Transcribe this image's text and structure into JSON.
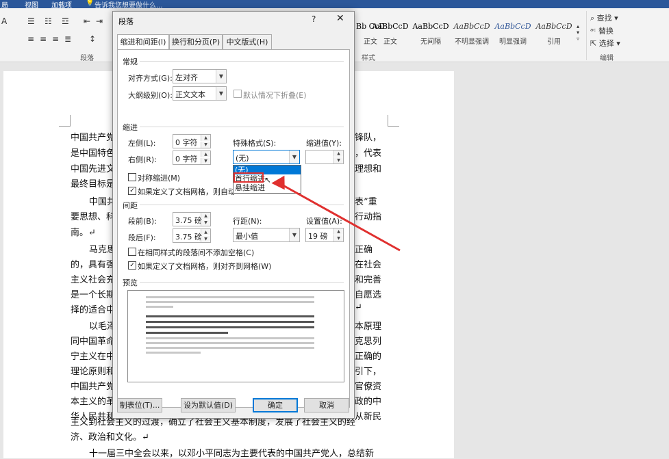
{
  "titlebar": {
    "items": [
      "局",
      "视图",
      "加载项",
      "告诉我您想要做什么..."
    ]
  },
  "ribbon": {
    "paragraph_group": "段落",
    "styles_group": "样式",
    "edit_group": "编辑",
    "styles": [
      {
        "preview": "Bb CcD",
        "name": "正文"
      },
      {
        "preview": "AaBbCcD",
        "name": "正文"
      },
      {
        "preview": "AaBbCcD",
        "name": "无间隔"
      },
      {
        "preview": "AaBbCcD",
        "name": "不明显强调"
      },
      {
        "preview": "AaBbCcD",
        "name": "明显强调"
      },
      {
        "preview": "AaBbCcD",
        "name": "引用"
      }
    ],
    "find": "查找",
    "replace": "替换",
    "select": "选择"
  },
  "document": {
    "lines": [
      {
        "left": "中国共产党",
        "right": "锋队，"
      },
      {
        "left": "是中国特色",
        "right": "，代表"
      },
      {
        "left": "中国先进文",
        "right": "理想和"
      },
      {
        "left": "最终目标是",
        "right": ""
      },
      {
        "left": "中国共",
        "right": "代表”重"
      },
      {
        "left": "要思想、科",
        "right": "行动指"
      },
      {
        "left": "南。↵",
        "right": ""
      },
      {
        "left": "马克思",
        "right": "正确"
      },
      {
        "left": "的，具有强",
        "right": "在社会"
      },
      {
        "left": "主义社会充",
        "right": "和完善"
      },
      {
        "left": "是一个长期",
        "right": "自愿选"
      },
      {
        "left": "择的适合中",
        "right": "↵"
      },
      {
        "left": "以毛泽",
        "right": "本原理"
      },
      {
        "left": "同中国革命",
        "right": "克思列"
      },
      {
        "left": "宁主义在中",
        "right": "正确的"
      },
      {
        "left": "理论原则和",
        "right": "引下，"
      },
      {
        "left": "中国共产党",
        "right": "官僚资"
      },
      {
        "left": "本主义的革",
        "right": "政的中"
      },
      {
        "left": "华人民共和",
        "right": "从新民"
      }
    ],
    "full_line_1": "主义到社会主义的过渡，确立了社会主义基本制度，发展了社会主义的经",
    "full_line_2": "济、政治和文化。↵",
    "full_line_3": "十一届三中全会以来，以邓小平同志为主要代表的中国共产党人，总结新"
  },
  "dialog": {
    "title": "段落",
    "help": "?",
    "tabs": [
      "缩进和间距(I)",
      "换行和分页(P)",
      "中文版式(H)"
    ],
    "general": {
      "section": "常规",
      "alignment_label": "对齐方式(G):",
      "alignment_value": "左对齐",
      "outline_label": "大纲级别(O):",
      "outline_value": "正文文本",
      "collapse_label": "默认情况下折叠(E)"
    },
    "indent": {
      "section": "缩进",
      "left_label": "左侧(L):",
      "left_value": "0 字符",
      "right_label": "右侧(R):",
      "right_value": "0 字符",
      "special_label": "特殊格式(S):",
      "special_value": "(无)",
      "by_label": "缩进值(Y):",
      "mirror_label": "对称缩进(M)",
      "grid_label": "如果定义了文档网格，则自动调整右缩进(D)",
      "dropdown_options": [
        "(无)",
        "首行缩进",
        "悬挂缩进"
      ]
    },
    "spacing": {
      "section": "间距",
      "before_label": "段前(B):",
      "before_value": "3.75 磅",
      "after_label": "段后(F):",
      "after_value": "3.75 磅",
      "line_label": "行距(N):",
      "line_value": "最小值",
      "at_label": "设置值(A):",
      "at_value": "19 磅",
      "no_space_label": "在相同样式的段落间不添加空格(C)",
      "snap_label": "如果定义了文档网格，则对齐到网格(W)"
    },
    "preview_section": "预览",
    "buttons": {
      "tabs": "制表位(T)...",
      "default": "设为默认值(D)",
      "ok": "确定",
      "cancel": "取消"
    }
  },
  "colors": {
    "accent": "#0078d7",
    "highlight": "#e0302f",
    "ribbon_blue": "#2b579a"
  }
}
